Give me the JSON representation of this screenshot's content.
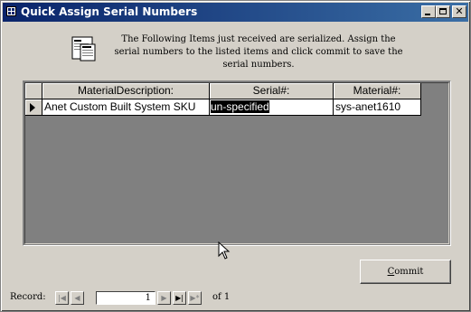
{
  "window": {
    "title": "Quick Assign Serial Numbers"
  },
  "header": {
    "icon": "form-serial-icon",
    "instructions": "The Following Items just received are serialized.  Assign the serial numbers to the listed items and click commit to save the serial numbers."
  },
  "datasheet": {
    "columns": [
      "MaterialDescription:",
      "Serial#:",
      "Material#:"
    ],
    "rows": [
      {
        "material_description": "Anet Custom Built System SKU",
        "serial": "un-specified",
        "material_number": "sys-anet1610"
      }
    ]
  },
  "buttons": {
    "commit_prefix": "C",
    "commit_rest": "ommit"
  },
  "navigation": {
    "record_label": "Record:",
    "first": "⏮",
    "prev": "◀",
    "current": "1",
    "next": "▶",
    "last": "⏭",
    "new": "▶*",
    "of_label": "of  1"
  }
}
